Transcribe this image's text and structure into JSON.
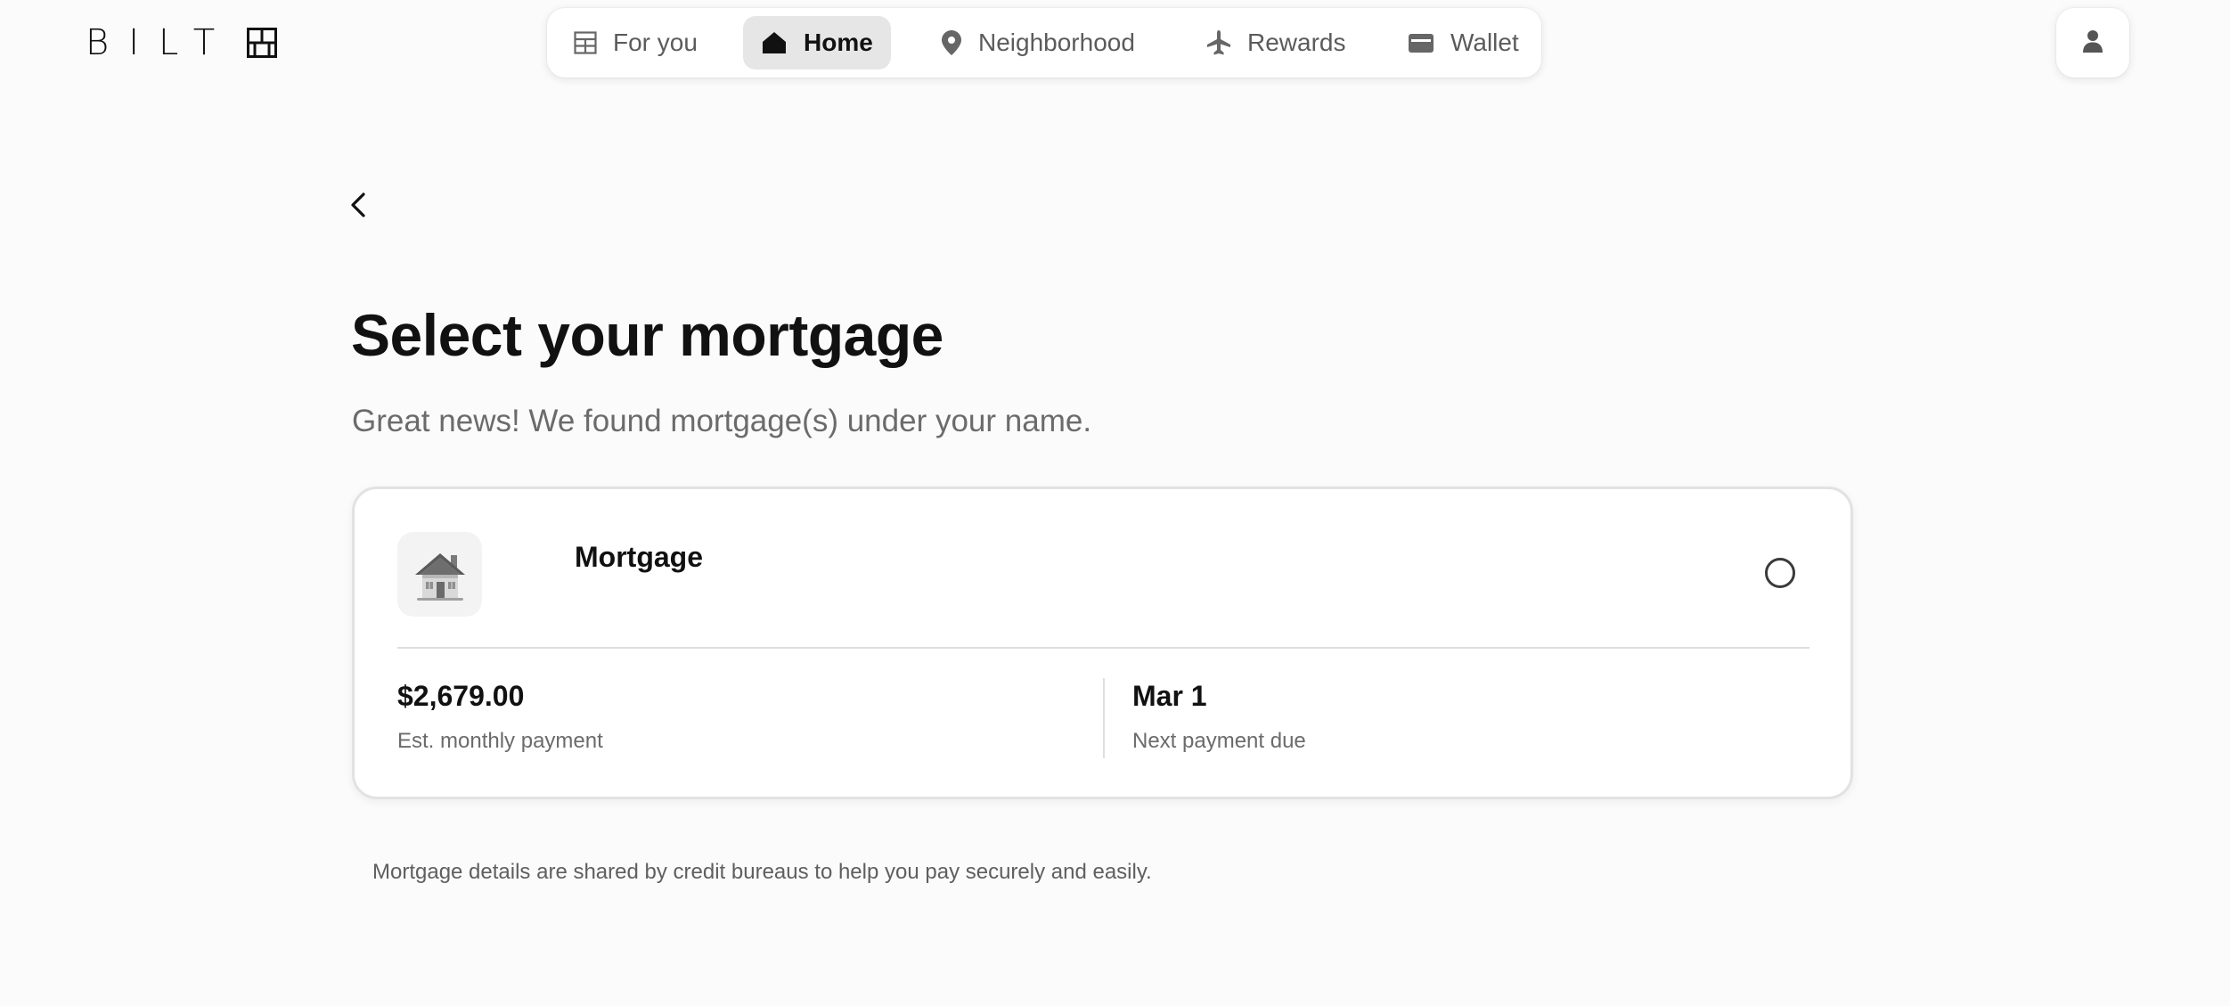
{
  "header": {
    "logo_text": "BILT",
    "logo_icon": "bilt-building-icon",
    "nav": [
      {
        "label": "For you",
        "icon": "grid-building-icon",
        "active": false
      },
      {
        "label": "Home",
        "icon": "home-icon",
        "active": true
      },
      {
        "label": "Neighborhood",
        "icon": "map-pin-icon",
        "active": false
      },
      {
        "label": "Rewards",
        "icon": "airplane-icon",
        "active": false
      },
      {
        "label": "Wallet",
        "icon": "wallet-icon",
        "active": false
      }
    ],
    "profile_icon": "user-icon"
  },
  "page": {
    "back_icon": "chevron-left-icon",
    "title": "Select your mortgage",
    "subtitle": "Great news! We found mortgage(s) under your name."
  },
  "mortgage_card": {
    "icon": "house-icon",
    "title": "Mortgage",
    "selected": false,
    "payment_value": "$2,679.00",
    "payment_label": "Est. monthly payment",
    "due_value": "Mar 1",
    "due_label": "Next payment due"
  },
  "footnote": "Mortgage details are shared by credit bureaus to help you pay securely and easily.",
  "colors": {
    "background": "#fbfbfc",
    "active_nav_bg": "#e6e6e6",
    "text_primary": "#111111",
    "text_secondary": "#6b6b6b"
  }
}
